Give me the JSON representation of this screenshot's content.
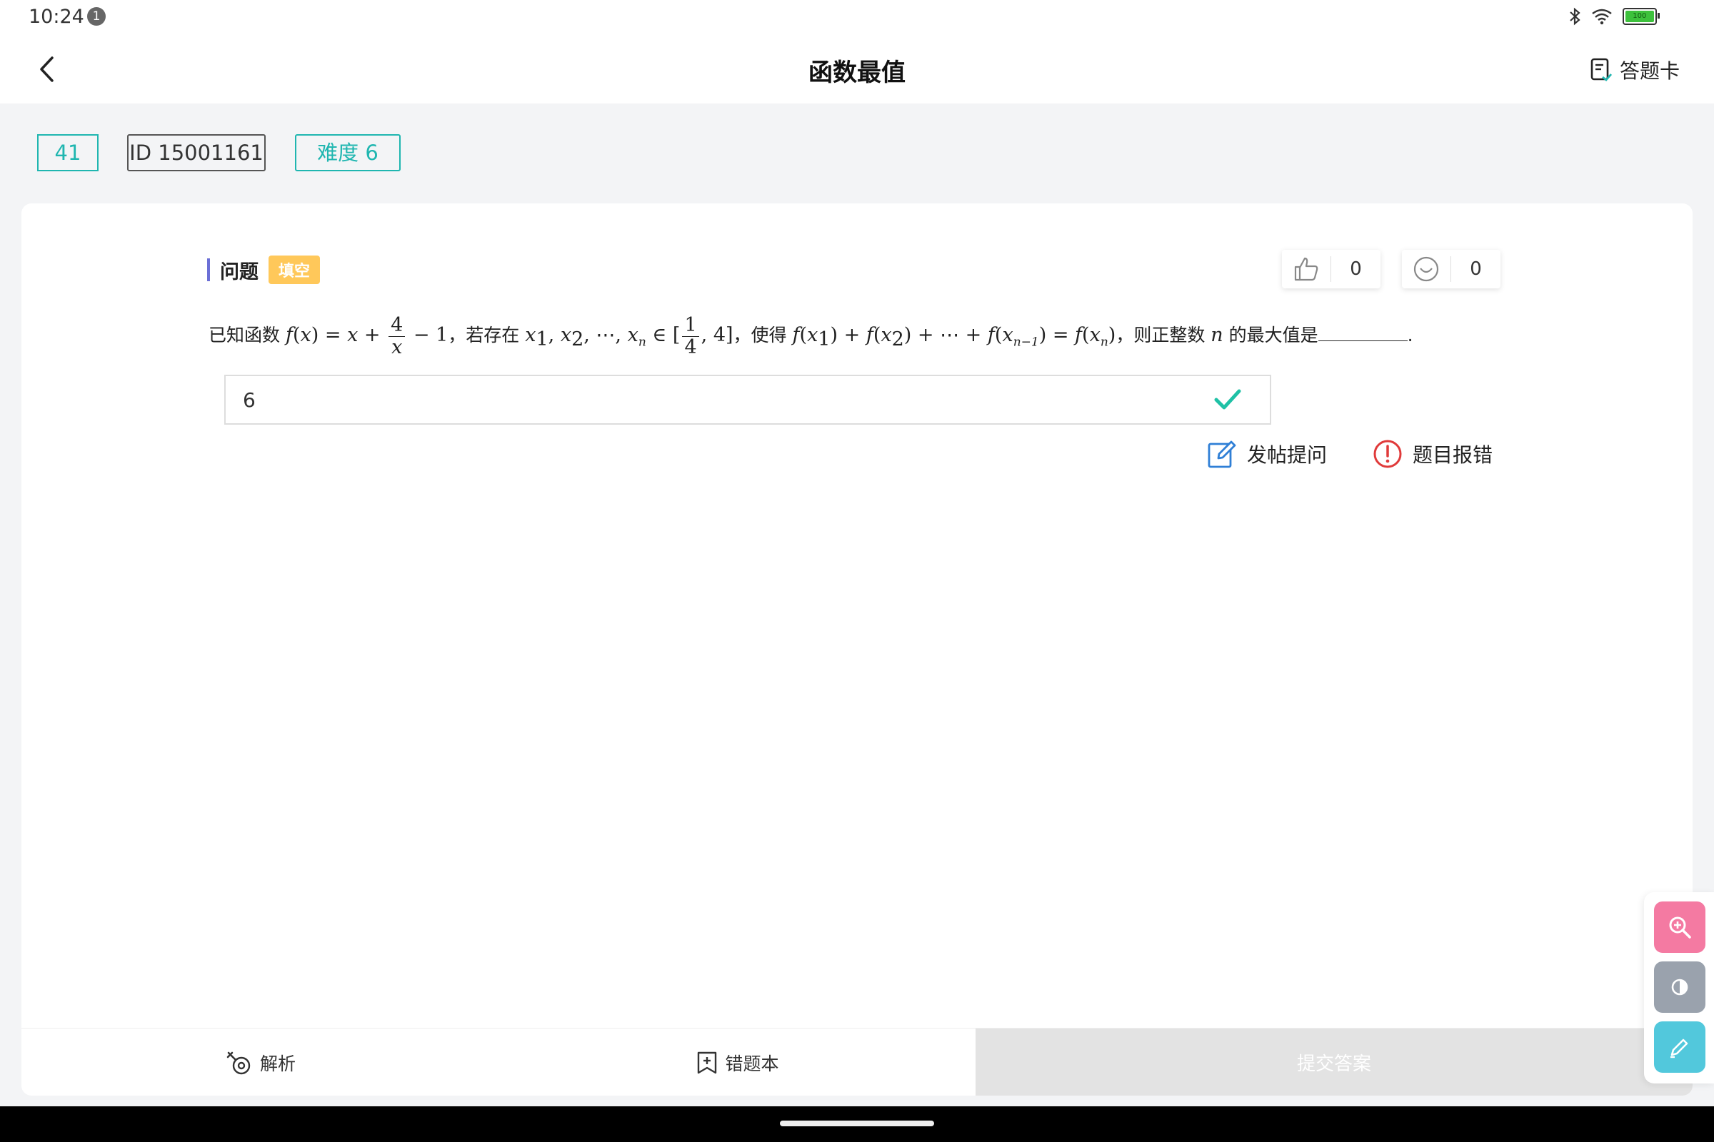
{
  "status": {
    "time": "10:24",
    "notification_count": "1",
    "battery_label": "100"
  },
  "header": {
    "title": "函数最值",
    "answer_card_label": "答题卡"
  },
  "tags": {
    "number": "41",
    "id": "ID 15001161",
    "difficulty": "难度 6"
  },
  "question": {
    "section_label": "问题",
    "type_badge": "填空",
    "likes": "0",
    "reactions": "0",
    "text_known_function": "已知函数",
    "text_if_exists": "，若存在",
    "text_such_that": "，使得",
    "text_then": "，则正整数",
    "text_max_value": "的最大值是",
    "text_end": "."
  },
  "answer": {
    "value": "6",
    "correct": true
  },
  "actions": {
    "post_question": "发帖提问",
    "report_error": "题目报错"
  },
  "bottom_bar": {
    "analysis": "解析",
    "wrong_book": "错题本",
    "submit": "提交答案"
  },
  "colors": {
    "accent": "#1fb6b0",
    "badge": "#ffc85a",
    "zoom": "#f47aa2",
    "contrast": "#9aa2ad",
    "pen": "#52c8dc",
    "report": "#e03a3a",
    "post": "#2f7fd6"
  }
}
